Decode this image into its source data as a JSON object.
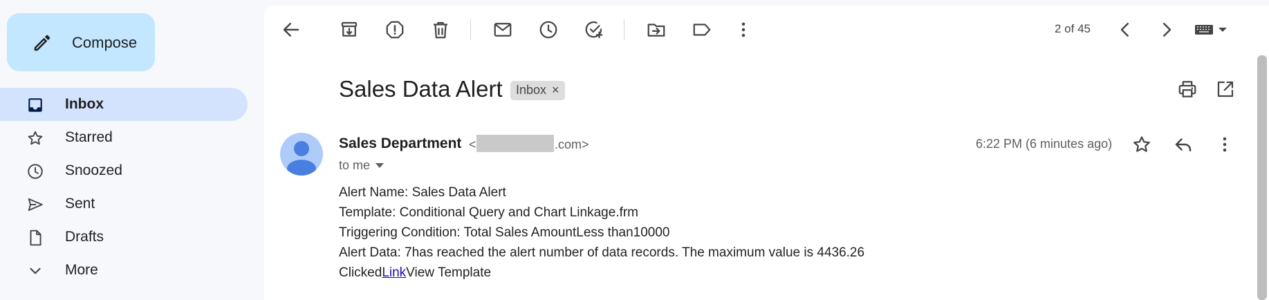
{
  "sidebar": {
    "compose_label": "Compose",
    "items": [
      {
        "label": "Inbox",
        "icon": "inbox-icon",
        "active": true
      },
      {
        "label": "Starred",
        "icon": "star-icon"
      },
      {
        "label": "Snoozed",
        "icon": "clock-icon"
      },
      {
        "label": "Sent",
        "icon": "send-icon"
      },
      {
        "label": "Drafts",
        "icon": "draft-icon"
      },
      {
        "label": "More",
        "icon": "chevron-down-icon"
      }
    ]
  },
  "toolbar": {
    "icons": [
      "back-arrow-icon",
      "archive-icon",
      "report-spam-icon",
      "delete-icon",
      "mark-unread-icon",
      "snooze-icon",
      "add-task-icon",
      "move-to-icon",
      "label-icon",
      "more-vert-icon"
    ],
    "pager": "2 of 45",
    "nav_icons": [
      "chevron-left-icon",
      "chevron-right-icon",
      "keyboard-icon"
    ]
  },
  "message": {
    "subject": "Sales Data Alert",
    "label_chip": "Inbox",
    "chip_close": "×",
    "sender_name": "Sales Department",
    "email_prefix": "<",
    "email_domain": ".com>",
    "recipient": "to me",
    "time": "6:22 PM (6 minutes ago)",
    "body": {
      "line1": "Alert Name: Sales Data Alert",
      "line2": "Template: Conditional Query and Chart Linkage.frm",
      "line3": "Triggering Condition: Total Sales AmountLess than10000",
      "line4": "Alert Data: 7has reached the alert number of data records. The maximum value is 4436.26",
      "line5_prefix": "Clicked",
      "line5_link": "Link",
      "line5_suffix": "View Template"
    }
  },
  "colors": {
    "compose_bg": "#c2e7ff",
    "active_nav_bg": "#d3e3fd",
    "avatar_bg": "#aecbfa",
    "avatar_figure": "#4a7fe0",
    "link": "#1a0dab"
  }
}
